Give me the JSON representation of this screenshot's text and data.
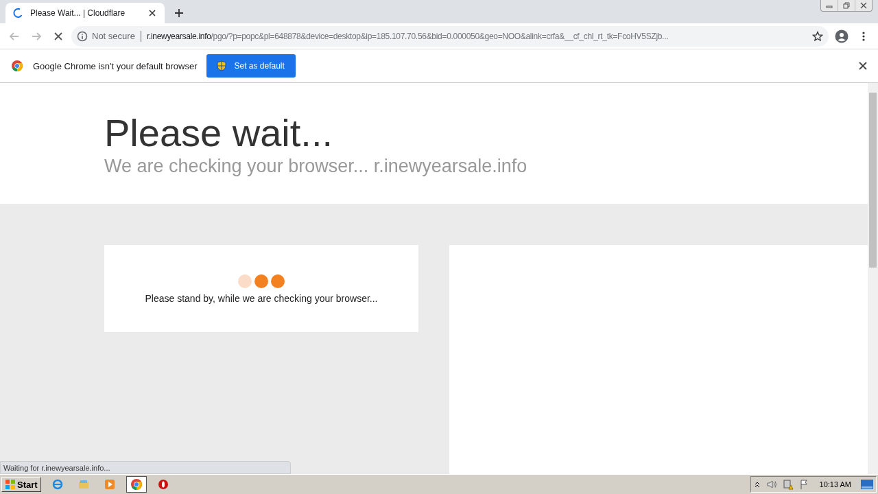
{
  "browser": {
    "tab": {
      "title": "Please Wait... | Cloudflare"
    },
    "address": {
      "security": "Not secure",
      "host": "r.inewyearsale.info",
      "path": "/pgo/?p=popc&pl=648878&device=desktop&ip=185.107.70.56&bid=0.000050&geo=NOO&alink=crfa&__cf_chl_rt_tk=FcoHV5SZjb..."
    },
    "infobar": {
      "message": "Google Chrome isn't your default browser",
      "button": "Set as default"
    }
  },
  "page": {
    "title": "Please wait...",
    "subtitle": "We are checking your browser... r.inewyearsale.info",
    "card_message": "Please stand by, while we are checking your browser..."
  },
  "status_bubble": "Waiting for r.inewyearsale.info...",
  "taskbar": {
    "start": "Start",
    "clock": "10:13 AM"
  }
}
